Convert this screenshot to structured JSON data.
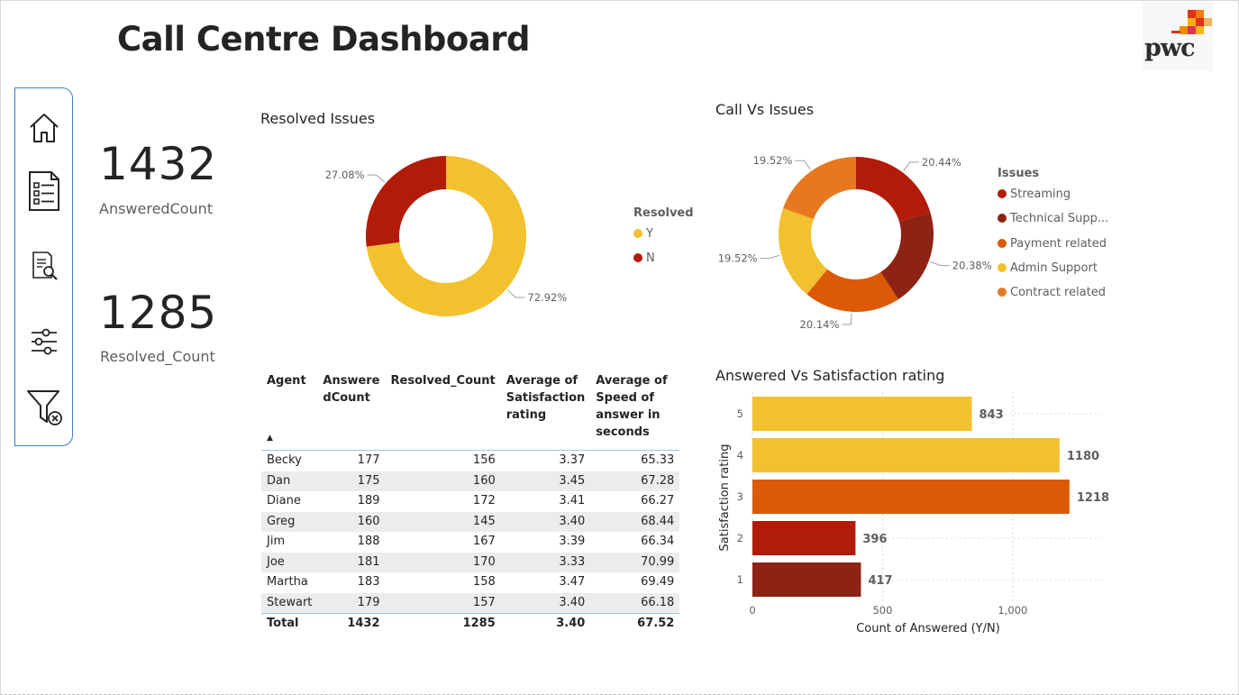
{
  "page": {
    "title": "Call Centre Dashboard",
    "logo_text": "pwc"
  },
  "nav": [
    {
      "name": "home-icon"
    },
    {
      "name": "checklist-report-icon"
    },
    {
      "name": "document-search-icon"
    },
    {
      "name": "sliders-icon"
    },
    {
      "name": "clear-filter-icon"
    }
  ],
  "kpis": {
    "answered": {
      "value": "1432",
      "label": "AnsweredCount"
    },
    "resolved": {
      "value": "1285",
      "label": "Resolved_Count"
    }
  },
  "resolved_issues": {
    "title": "Resolved Issues",
    "legend_title": "Resolved",
    "chart_data": {
      "type": "pie",
      "categories": [
        "Y",
        "N"
      ],
      "values": [
        72.92,
        27.08
      ],
      "data_labels": [
        "72.92%",
        "27.08%"
      ],
      "colors": [
        "#F2C12E",
        "#B21B08"
      ],
      "legend_position": "right"
    }
  },
  "call_vs_issues": {
    "title": "Call Vs Issues",
    "legend_title": "Issues",
    "legend_labels": [
      "Streaming",
      "Technical Supp...",
      "Payment related",
      "Admin Support",
      "Contract related"
    ],
    "chart_data": {
      "type": "pie",
      "categories": [
        "Streaming",
        "Technical Support",
        "Payment related",
        "Admin Support",
        "Contract related"
      ],
      "values": [
        20.44,
        20.38,
        20.14,
        19.52,
        19.52
      ],
      "data_labels": [
        "20.44%",
        "20.38%",
        "20.14%",
        "19.52%",
        "19.52%"
      ],
      "colors": [
        "#B21B08",
        "#8C2314",
        "#DC5905",
        "#F2C12E",
        "#E8781F"
      ],
      "legend_position": "right"
    }
  },
  "table": {
    "headers": [
      "Agent",
      "AnsweredCount",
      "Resolved_Count",
      "Average of Satisfaction rating",
      "Average of Speed of answer in seconds"
    ],
    "header_lines": [
      [
        "Agent"
      ],
      [
        "Answere",
        "dCount"
      ],
      [
        "Resolved_Count"
      ],
      [
        "Average of",
        "Satisfaction",
        "rating"
      ],
      [
        "Average of",
        "Speed of",
        "answer in",
        "seconds"
      ]
    ],
    "sort_indicator": "▲",
    "rows": [
      [
        "Becky",
        "177",
        "156",
        "3.37",
        "65.33"
      ],
      [
        "Dan",
        "175",
        "160",
        "3.45",
        "67.28"
      ],
      [
        "Diane",
        "189",
        "172",
        "3.41",
        "66.27"
      ],
      [
        "Greg",
        "160",
        "145",
        "3.40",
        "68.44"
      ],
      [
        "Jim",
        "188",
        "167",
        "3.39",
        "66.34"
      ],
      [
        "Joe",
        "181",
        "170",
        "3.33",
        "70.99"
      ],
      [
        "Martha",
        "183",
        "158",
        "3.47",
        "69.49"
      ],
      [
        "Stewart",
        "179",
        "157",
        "3.40",
        "66.18"
      ]
    ],
    "total": [
      "Total",
      "1432",
      "1285",
      "3.40",
      "67.52"
    ]
  },
  "answered_vs_satisfaction": {
    "title": "Answered Vs Satisfaction rating",
    "chart_data": {
      "type": "bar",
      "orientation": "horizontal",
      "categories": [
        "5",
        "4",
        "3",
        "2",
        "1"
      ],
      "values": [
        843,
        1180,
        1218,
        396,
        417
      ],
      "colors": [
        "#F2C12E",
        "#F2C12E",
        "#DC5905",
        "#B21B08",
        "#8C2314"
      ],
      "xlabel": "Count of Answered (Y/N)",
      "ylabel": "Satisfaction rating",
      "xticks": [
        "0",
        "500",
        "1,000"
      ],
      "xtick_values": [
        0,
        500,
        1000
      ],
      "xlim": [
        0,
        1350
      ],
      "grid": true
    }
  }
}
